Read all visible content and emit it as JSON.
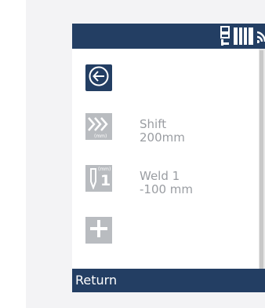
{
  "header": {
    "icons": [
      "sensor-icon",
      "battery-icon",
      "wifi-icon"
    ]
  },
  "items": [
    {
      "name": "back",
      "icon": "back-arrow-icon"
    },
    {
      "name": "shift",
      "icon": "shift-chevrons-icon",
      "unit": "(mm)",
      "title": "Shift",
      "value": "200mm"
    },
    {
      "name": "weld",
      "icon": "weld-marker-icon",
      "unit": "(mm)",
      "index": "1",
      "title": "Weld 1",
      "value": "-100 mm"
    },
    {
      "name": "add",
      "icon": "plus-icon"
    }
  ],
  "footer": {
    "label": "Return"
  },
  "colors": {
    "header_bg": "#233e63",
    "tile_gray": "#b9bcc0",
    "text_gray": "#9a9da2",
    "page_bg": "#f3f3f5"
  }
}
